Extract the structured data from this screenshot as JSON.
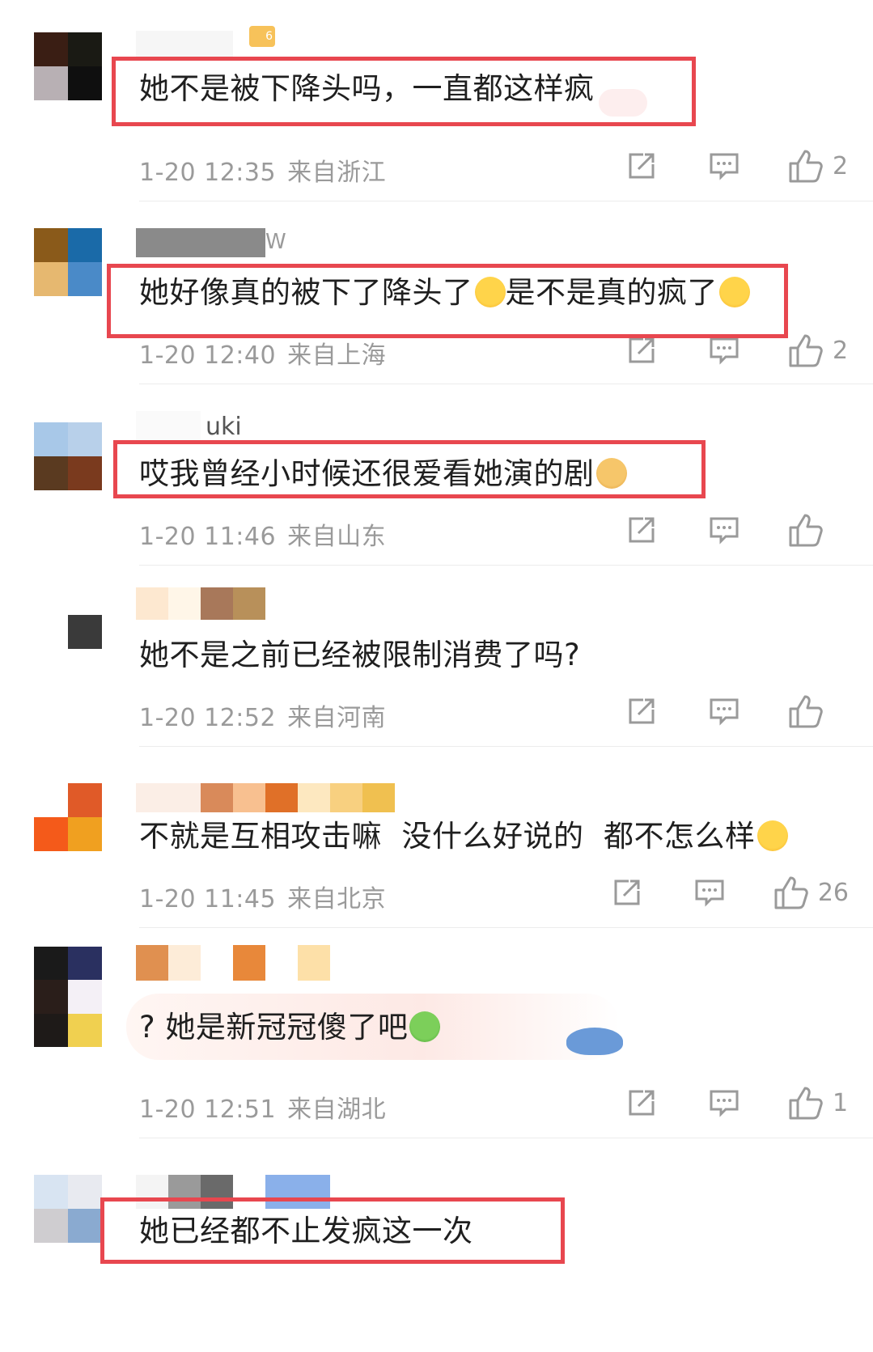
{
  "comments": [
    {
      "text": "她不是被下降头吗，一直都这样疯",
      "date": "1-20 12:35",
      "location": "来自浙江",
      "likes": "2",
      "level_badge": "6"
    },
    {
      "name": "W",
      "text": "她好像真的被下了降头了",
      "text2": "是不是真的疯了",
      "emoji1": "laugh-cry-emoji",
      "emoji2": "dizzy-emoji",
      "date": "1-20 12:40",
      "location": "来自上海",
      "likes": "2"
    },
    {
      "name": "uki",
      "text": "哎我曾经小时候还很爱看她演的剧",
      "emoji1": "cat-emoji",
      "date": "1-20 11:46",
      "location": "来自山东",
      "likes": ""
    },
    {
      "text": "她不是之前已经被限制消费了吗?",
      "date": "1-20 12:52",
      "location": "来自河南",
      "likes": ""
    },
    {
      "text": "不就是互相攻击嘛  没什么好说的  都不怎么样",
      "emoji1": "smirk-emoji",
      "date": "1-20 11:45",
      "location": "来自北京",
      "likes": "26"
    },
    {
      "text": "? 她是新冠冠傻了吧",
      "emoji1": "frog-emoji",
      "date": "1-20 12:51",
      "location": "来自湖北",
      "likes": "1"
    },
    {
      "text": "她已经都不止发疯这一次"
    }
  ],
  "colors": {
    "highlight_box": "#e8474f",
    "meta_text": "#9a9a9a",
    "icon": "#9a9a9a"
  }
}
